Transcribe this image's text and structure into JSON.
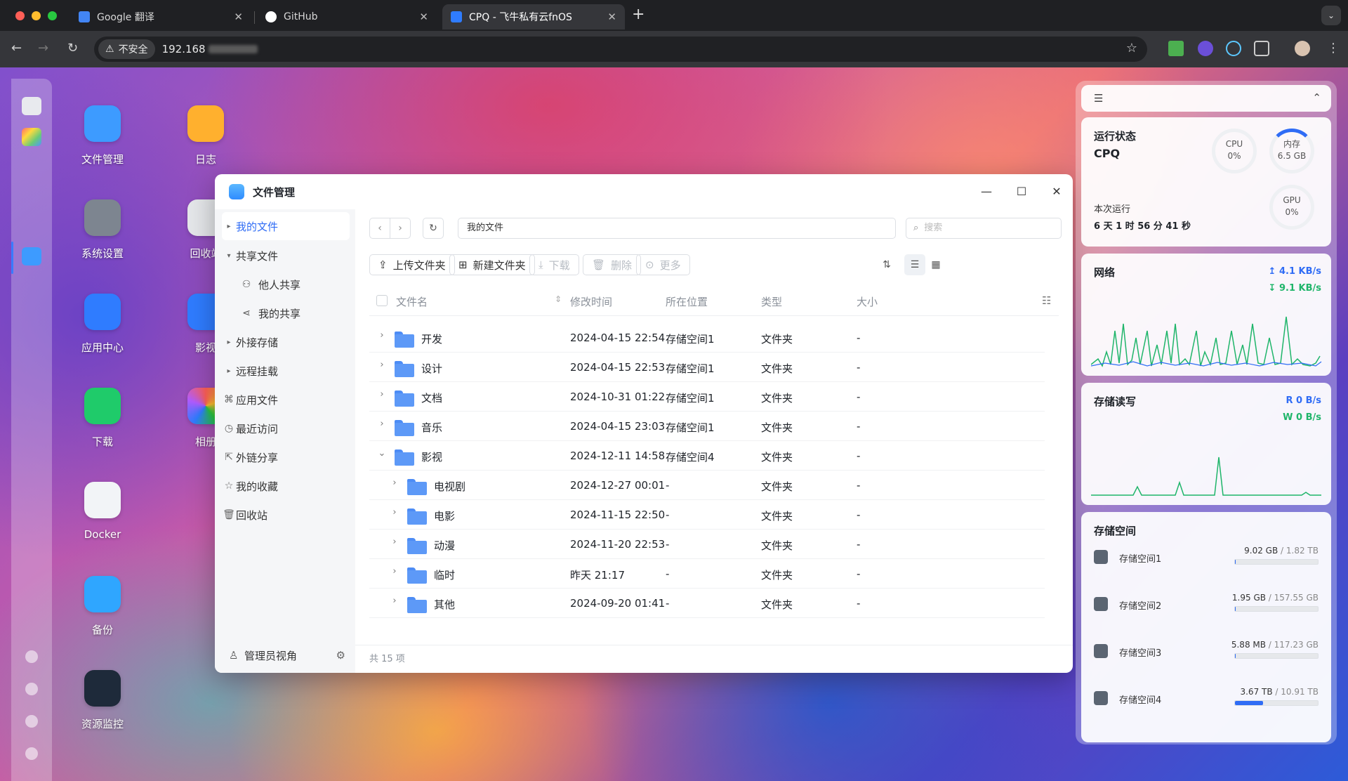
{
  "browser": {
    "tabs": [
      {
        "title": "Google 翻译",
        "active": false,
        "icon": "google-translate-icon"
      },
      {
        "title": "GitHub",
        "active": false,
        "icon": "github-icon"
      },
      {
        "title": "CPQ - 飞牛私有云fnOS",
        "active": true,
        "icon": "fnos-icon"
      }
    ],
    "security_label": "不安全",
    "url": "192.168"
  },
  "desktop": {
    "apps": [
      {
        "label": "文件管理",
        "icon": "file-manager-icon",
        "color": "#3d9bff"
      },
      {
        "label": "日志",
        "icon": "log-icon",
        "color": "#ffb02e"
      },
      {
        "label": "系统设置",
        "icon": "gear-icon",
        "color": "#7d8590"
      },
      {
        "label": "回收站",
        "icon": "recycle-bin-icon",
        "color": "#e5e7ea"
      },
      {
        "label": "应用中心",
        "icon": "app-store-icon",
        "color": "#2f7cff"
      },
      {
        "label": "影视",
        "icon": "video-icon",
        "color": "#2f7cff"
      },
      {
        "label": "下载",
        "icon": "download-icon",
        "color": "#1fcb6a"
      },
      {
        "label": "相册",
        "icon": "photos-icon",
        "color": "#f5f5f5"
      },
      {
        "label": "Docker",
        "icon": "docker-icon",
        "color": "#f2f4f7"
      },
      {
        "label": "备份",
        "icon": "backup-icon",
        "color": "#2fa6ff"
      },
      {
        "label": "资源监控",
        "icon": "resource-monitor-icon",
        "color": "#1e2a3a"
      }
    ]
  },
  "file_manager": {
    "title": "文件管理",
    "sidebar": [
      {
        "label": "我的文件",
        "selected": true,
        "icon": "caret-right-icon"
      },
      {
        "label": "共享文件",
        "selected": false,
        "icon": "caret-down-icon"
      },
      {
        "label": "他人共享",
        "selected": false,
        "icon": "users-icon"
      },
      {
        "label": "我的共享",
        "selected": false,
        "icon": "share-icon"
      },
      {
        "label": "外接存储",
        "selected": false,
        "icon": "caret-right-icon"
      },
      {
        "label": "远程挂载",
        "selected": false,
        "icon": "caret-right-icon"
      },
      {
        "label": "应用文件",
        "selected": false,
        "icon": "apps-icon"
      },
      {
        "label": "最近访问",
        "selected": false,
        "icon": "clock-icon"
      },
      {
        "label": "外链分享",
        "selected": false,
        "icon": "external-link-icon"
      },
      {
        "label": "我的收藏",
        "selected": false,
        "icon": "star-icon"
      },
      {
        "label": "回收站",
        "selected": false,
        "icon": "trash-icon"
      }
    ],
    "admin_view": "管理员视角",
    "path": "我的文件",
    "search_placeholder": "搜索",
    "toolbar": {
      "upload": "上传文件夹",
      "new_folder": "新建文件夹",
      "download": "下载",
      "delete": "删除",
      "more": "更多"
    },
    "columns": [
      "文件名",
      "修改时间",
      "所在位置",
      "类型",
      "大小"
    ],
    "rows": [
      {
        "name": "开发",
        "modified": "2024-04-15 22:54",
        "location": "存储空间1",
        "type": "文件夹",
        "size": "-",
        "level": 0,
        "expanded": false
      },
      {
        "name": "设计",
        "modified": "2024-04-15 22:53",
        "location": "存储空间1",
        "type": "文件夹",
        "size": "-",
        "level": 0,
        "expanded": false
      },
      {
        "name": "文档",
        "modified": "2024-10-31 01:22",
        "location": "存储空间1",
        "type": "文件夹",
        "size": "-",
        "level": 0,
        "expanded": false
      },
      {
        "name": "音乐",
        "modified": "2024-04-15 23:03",
        "location": "存储空间1",
        "type": "文件夹",
        "size": "-",
        "level": 0,
        "expanded": false
      },
      {
        "name": "影视",
        "modified": "2024-12-11 14:58",
        "location": "存储空间4",
        "type": "文件夹",
        "size": "-",
        "level": 0,
        "expanded": true
      },
      {
        "name": "电视剧",
        "modified": "2024-12-27 00:01",
        "location": "-",
        "type": "文件夹",
        "size": "-",
        "level": 1,
        "expanded": false
      },
      {
        "name": "电影",
        "modified": "2024-11-15 22:50",
        "location": "-",
        "type": "文件夹",
        "size": "-",
        "level": 1,
        "expanded": false
      },
      {
        "name": "动漫",
        "modified": "2024-11-20 22:53",
        "location": "-",
        "type": "文件夹",
        "size": "-",
        "level": 1,
        "expanded": false
      },
      {
        "name": "临时",
        "modified": "昨天 21:17",
        "location": "-",
        "type": "文件夹",
        "size": "-",
        "level": 1,
        "expanded": false
      },
      {
        "name": "其他",
        "modified": "2024-09-20 01:41",
        "location": "-",
        "type": "文件夹",
        "size": "-",
        "level": 1,
        "expanded": false
      }
    ],
    "item_count": "共 15 项"
  },
  "widgets": {
    "status": {
      "title": "运行状态",
      "host": "CPQ",
      "cpu_label": "CPU",
      "cpu_value": "0%",
      "mem_label": "内存",
      "mem_value": "6.5 GB",
      "gpu_label": "GPU",
      "gpu_value": "0%",
      "uptime_label": "本次运行",
      "uptime": "6 天 1 时 56 分 41 秒"
    },
    "network": {
      "title": "网络",
      "up": "4.1 KB/s",
      "down": "9.1 KB/s"
    },
    "disk_io": {
      "title": "存储读写",
      "read": "R 0 B/s",
      "write": "W 0 B/s"
    },
    "storage": {
      "title": "存储空间",
      "volumes": [
        {
          "name": "存储空间1",
          "used": "9.02 GB",
          "total": "1.82 TB",
          "fraction": 0.005
        },
        {
          "name": "存储空间2",
          "used": "1.95 GB",
          "total": "157.55 GB",
          "fraction": 0.012
        },
        {
          "name": "存储空间3",
          "used": "5.88 MB",
          "total": "117.23 GB",
          "fraction": 0.0001
        },
        {
          "name": "存储空间4",
          "used": "3.67 TB",
          "total": "10.91 TB",
          "fraction": 0.336
        }
      ]
    }
  }
}
